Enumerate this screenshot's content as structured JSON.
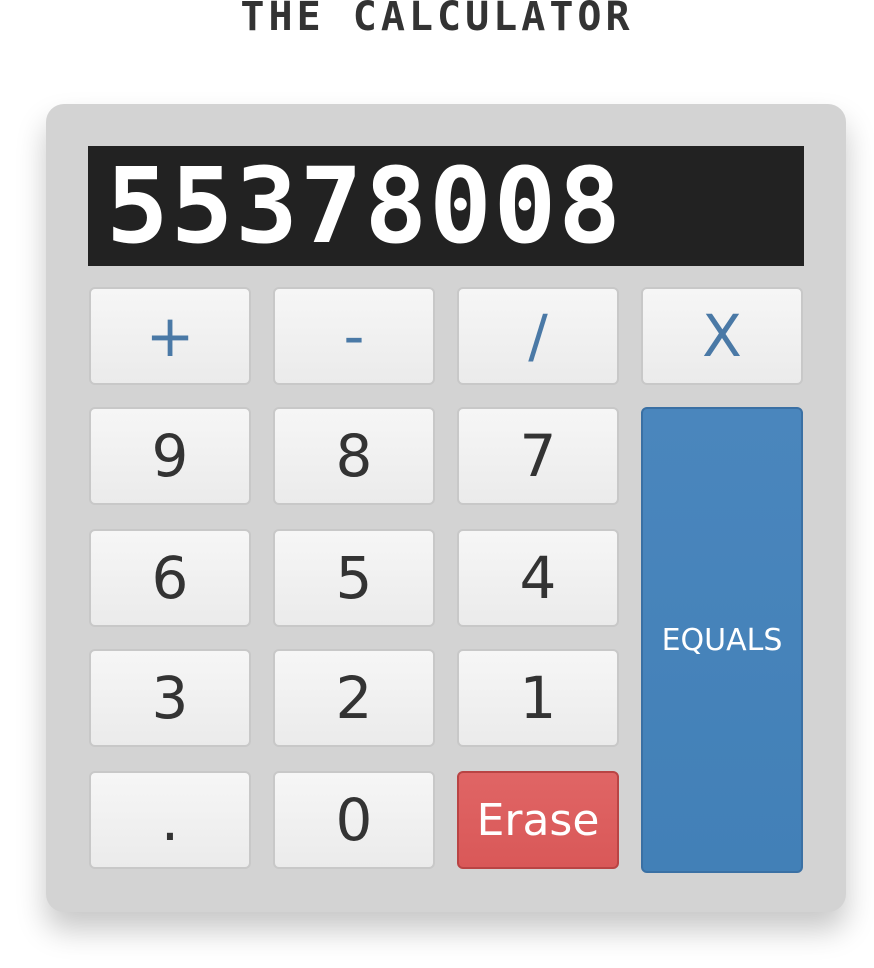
{
  "title": "THE CALCULATOR",
  "display": {
    "value": "55378008"
  },
  "operators": {
    "add": "+",
    "subtract": "-",
    "divide": "/",
    "multiply": "X"
  },
  "digits": {
    "d9": "9",
    "d8": "8",
    "d7": "7",
    "d6": "6",
    "d5": "5",
    "d4": "4",
    "d3": "3",
    "d2": "2",
    "d1": "1",
    "d0": "0"
  },
  "keys": {
    "decimal": ".",
    "erase": "Erase",
    "equals": "EQUALS"
  },
  "colors": {
    "display_bg": "#222222",
    "operator_text": "#4a79a6",
    "erase": "#d95858",
    "equals": "#4280b7",
    "body": "#d3d3d3"
  }
}
